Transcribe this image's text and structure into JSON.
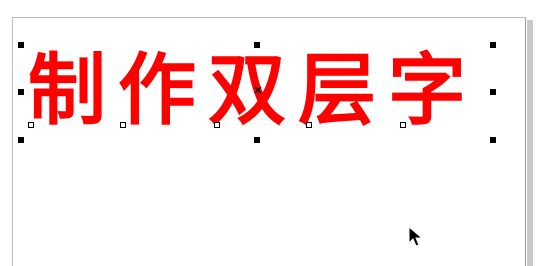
{
  "canvas": {
    "background_color": "#ffffff",
    "page_border_color": "#bdbdbd"
  },
  "artistic_text": {
    "content": "制作双层字",
    "fill_color": "#ff0000"
  },
  "selection": {
    "handle_color": "#000000",
    "center_marker": "x-icon"
  },
  "pointer": {
    "icon": "arrow-cursor-icon"
  }
}
